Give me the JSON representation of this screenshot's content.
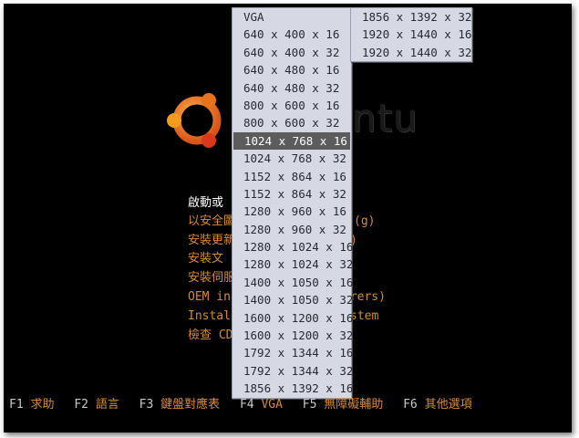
{
  "brand": {
    "text": "ubuntu",
    "visible_fragment": "ntu"
  },
  "boot_menu": {
    "items": [
      {
        "label": "啟動或安裝 Ubuntu",
        "visible": "啟動或",
        "selected": true
      },
      {
        "label": "以安全圖形模式啟動或安裝 Ubuntu",
        "visible": "以安全圖",
        "tail": "(g)"
      },
      {
        "label": "安裝更新",
        "visible": "安裝更新",
        "tail": ")"
      },
      {
        "label": "安裝文字",
        "visible": "安裝文"
      },
      {
        "label": "安裝伺服器",
        "visible": "安裝伺服"
      },
      {
        "label": "OEM install (for manufacturers)",
        "visible": "OEM ins",
        "tail": "urers)"
      },
      {
        "label": "Install a command-line system",
        "visible": "Install",
        "tail": "stem"
      },
      {
        "label": "檢查 CD 是否有缺陷",
        "visible": "檢查 CD"
      }
    ]
  },
  "resolution_menu": {
    "column1": [
      "VGA",
      "640 x 400 x 16",
      "640 x 400 x 32",
      "640 x 480 x 16",
      "640 x 480 x 32",
      "800 x 600 x 16",
      "800 x 600 x 32",
      "1024 x 768 x 16",
      "1024 x 768 x 32",
      "1152 x 864 x 16",
      "1152 x 864 x 32",
      "1280 x 960 x 16",
      "1280 x 960 x 32",
      "1280 x 1024 x 16",
      "1280 x 1024 x 32",
      "1400 x 1050 x 16",
      "1400 x 1050 x 32",
      "1600 x 1200 x 16",
      "1600 x 1200 x 32",
      "1792 x 1344 x 16",
      "1792 x 1344 x 32",
      "1856 x 1392 x 16"
    ],
    "column2": [
      "1856 x 1392 x 32",
      "1920 x 1440 x 16",
      "1920 x 1440 x 32"
    ],
    "selected": "1024 x 768 x 16"
  },
  "fkeys": [
    {
      "key": "F1",
      "label": "求助"
    },
    {
      "key": "F2",
      "label": "語言"
    },
    {
      "key": "F3",
      "label": "鍵盤對應表"
    },
    {
      "key": "F4",
      "label": "VGA"
    },
    {
      "key": "F5",
      "label": "無障礙輔助"
    },
    {
      "key": "F6",
      "label": "其他選項"
    }
  ],
  "colors": {
    "background": "#000000",
    "menu_text": "#d98a2e",
    "dropdown_bg": "#d6d9e4",
    "dropdown_selected": "#5c5c5c",
    "logo_orange": "#e8741a",
    "logo_red": "#d9391a",
    "logo_yellow": "#f3a712"
  }
}
